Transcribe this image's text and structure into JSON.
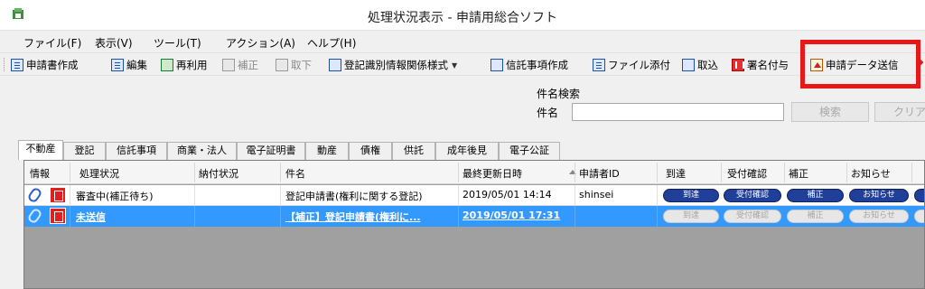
{
  "window": {
    "title": "処理状況表示 - 申請用総合ソフト",
    "icon": "app-icon"
  },
  "menubar": [
    {
      "label": "ファイル(F)"
    },
    {
      "label": "表示(V)"
    },
    {
      "label": "ツール(T)"
    },
    {
      "label": "アクション(A)"
    },
    {
      "label": "ヘルプ(H)"
    }
  ],
  "toolbar": [
    {
      "label": "申請書作成",
      "icon": "create-form-icon",
      "enabled": true
    },
    {
      "label": "編集",
      "icon": "edit-icon",
      "enabled": true
    },
    {
      "label": "再利用",
      "icon": "reuse-icon",
      "enabled": true
    },
    {
      "label": "補正",
      "icon": "amend-icon",
      "enabled": false
    },
    {
      "label": "取下",
      "icon": "withdraw-icon",
      "enabled": false
    },
    {
      "label": "登記識別情報関係様式",
      "icon": "registration-form-icon",
      "enabled": true,
      "dropdown": true
    },
    {
      "label": "信託事項作成",
      "icon": "trust-icon",
      "enabled": true
    },
    {
      "label": "ファイル添付",
      "icon": "attach-file-icon",
      "enabled": true
    },
    {
      "label": "取込",
      "icon": "import-icon",
      "enabled": true
    },
    {
      "label": "署名付与",
      "icon": "signature-icon",
      "enabled": true
    },
    {
      "label": "申請データ送信",
      "icon": "send-data-icon",
      "enabled": true,
      "highlighted": true
    }
  ],
  "search": {
    "group_label": "件名検索",
    "field_label": "件名",
    "value": "",
    "search_button": "検索",
    "clear_button": "クリア"
  },
  "tabs": [
    {
      "label": "不動産",
      "active": true
    },
    {
      "label": "登記"
    },
    {
      "label": "信託事項"
    },
    {
      "label": "商業・法人"
    },
    {
      "label": "電子証明書"
    },
    {
      "label": "動産"
    },
    {
      "label": "債権"
    },
    {
      "label": "供託"
    },
    {
      "label": "成年後見"
    },
    {
      "label": "電子公証"
    }
  ],
  "table": {
    "columns": [
      "情報",
      "処理状況",
      "納付状況",
      "件名",
      "最終更新日時",
      "申請者ID",
      "到達",
      "受付確認",
      "補正",
      "お知らせ"
    ],
    "rows": [
      {
        "status": "審査中(補正待ち)",
        "payment": "",
        "subject": "登記申請書(権利に関する登記)",
        "updated": "2019/05/01 14:14",
        "applicant": "shinsei",
        "arrival": "到達",
        "receipt": "受付確認",
        "amend": "補正",
        "notice": "お知らせ",
        "selected": false
      },
      {
        "status": "未送信",
        "payment": "",
        "subject": "【補正】登記申請書(権利に...",
        "updated": "2019/05/01 17:31",
        "applicant": "",
        "arrival": "到達",
        "receipt": "受付確認",
        "amend": "補正",
        "notice": "お知らせ",
        "selected": true
      }
    ]
  },
  "colors": {
    "selection": "#3399ff",
    "highlight_box": "#e81818",
    "active_pill": "#1f3f98",
    "stamp": "#e01f1f"
  }
}
